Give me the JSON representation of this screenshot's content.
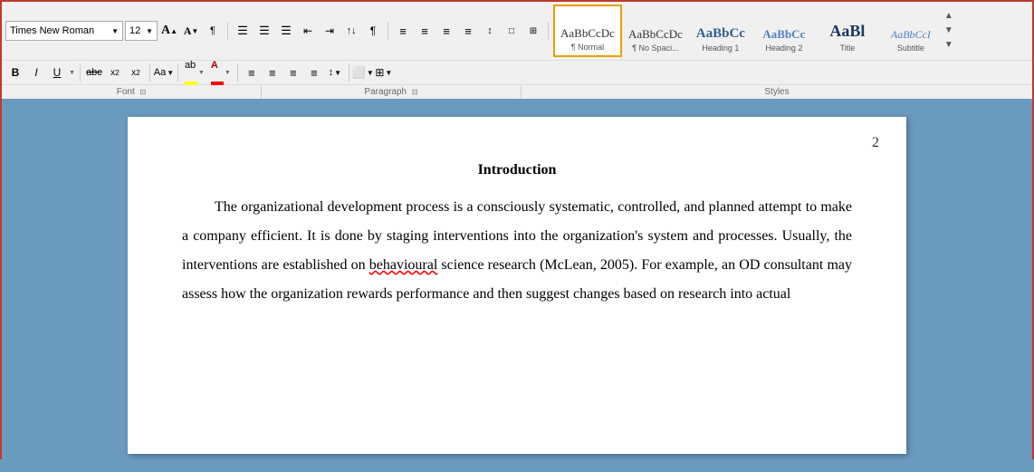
{
  "toolbar": {
    "font_name": "Times New Roman",
    "font_size": "12",
    "row1_buttons": [
      {
        "label": "A",
        "name": "grow-font",
        "title": "Grow Font"
      },
      {
        "label": "A",
        "name": "shrink-font",
        "title": "Shrink Font"
      },
      {
        "label": "¶",
        "name": "clear-format",
        "title": "Clear Formatting"
      }
    ],
    "list_buttons": [
      {
        "label": "≡",
        "name": "bullets"
      },
      {
        "label": "≡",
        "name": "numbering"
      },
      {
        "label": "≡",
        "name": "multilevel"
      },
      {
        "label": "↓↑",
        "name": "sort"
      },
      {
        "label": "↑",
        "name": "increase-indent"
      },
      {
        "label": "↓",
        "name": "decrease-indent"
      },
      {
        "label": "¶",
        "name": "show-marks"
      }
    ],
    "align_buttons": [
      {
        "label": "≡",
        "name": "align-left"
      },
      {
        "label": "≡",
        "name": "align-center"
      },
      {
        "label": "≡",
        "name": "align-right"
      },
      {
        "label": "≡",
        "name": "justify"
      },
      {
        "label": "↕",
        "name": "line-spacing"
      },
      {
        "label": "□",
        "name": "shading"
      },
      {
        "label": "⊞",
        "name": "borders"
      }
    ],
    "format_buttons": [
      {
        "label": "B",
        "name": "bold"
      },
      {
        "label": "I",
        "name": "italic"
      },
      {
        "label": "U",
        "name": "underline"
      },
      {
        "label": "ab",
        "name": "strikethrough"
      },
      {
        "label": "x₂",
        "name": "subscript"
      },
      {
        "label": "x²",
        "name": "superscript"
      },
      {
        "label": "Aa",
        "name": "change-case"
      }
    ],
    "group_labels": [
      "Font",
      "Paragraph",
      "Styles"
    ]
  },
  "styles": [
    {
      "name": "normal",
      "preview": "AaBbCcDc",
      "label": "¶ Normal",
      "selected": true
    },
    {
      "name": "no-spacing",
      "preview": "AaBbCcDc",
      "label": "¶ No Spaci...",
      "selected": false
    },
    {
      "name": "heading1",
      "preview": "AaBbCc",
      "label": "Heading 1",
      "selected": false
    },
    {
      "name": "heading2",
      "preview": "AaBbCc",
      "label": "Heading 2",
      "selected": false
    },
    {
      "name": "title",
      "preview": "AaBl",
      "label": "Title",
      "selected": false
    },
    {
      "name": "subtitle",
      "preview": "AaBbCcI",
      "label": "Subtitle",
      "selected": false
    }
  ],
  "document": {
    "page_number": "2",
    "title": "Introduction",
    "body": "The organizational development process is a consciously systematic, controlled, and planned attempt to make a company efficient. It is done by staging interventions into the organization's system and processes. Usually, the interventions are established on behavioural science research (McLean, 2005). For example, an OD consultant may assess how the organization rewards performance and then suggest changes based on research into actual"
  }
}
